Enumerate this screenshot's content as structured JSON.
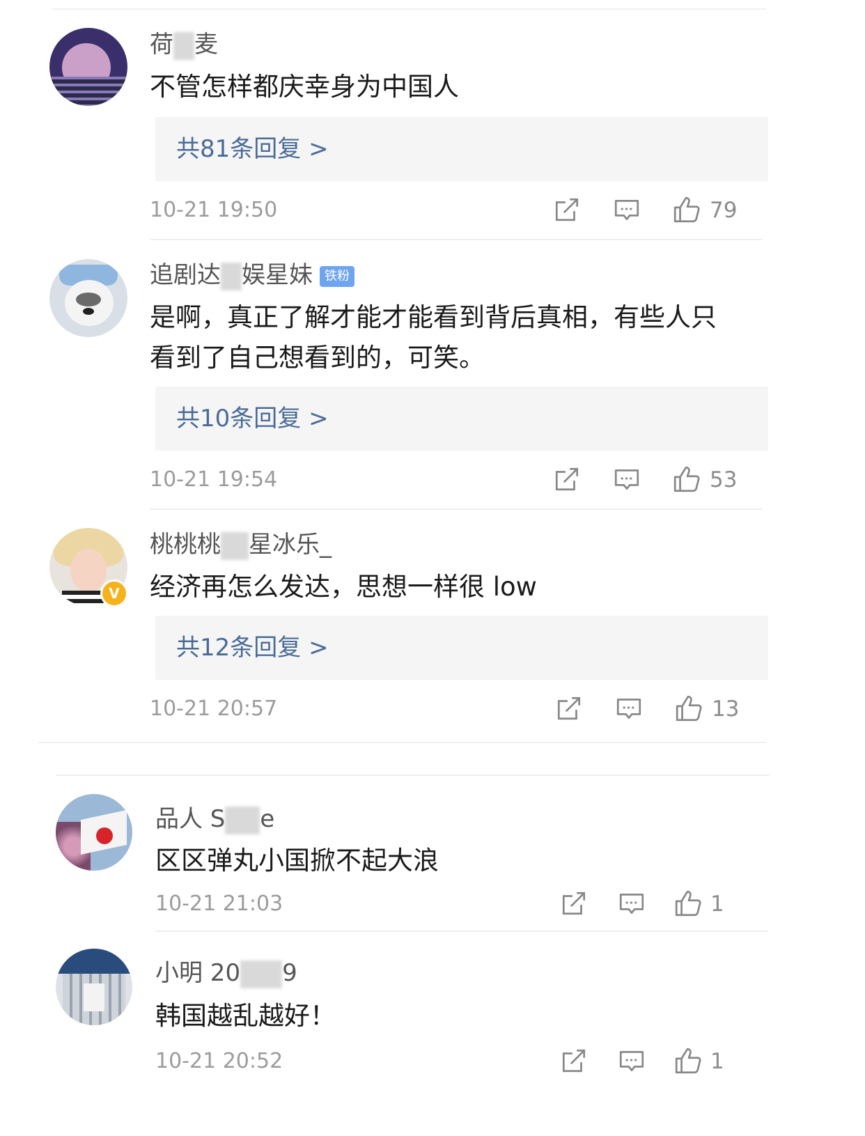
{
  "comments": [
    {
      "username_pre": "荷",
      "username_post": "麦",
      "text": "不管怎样都庆幸身为中国人",
      "replies": "共81条回复 >",
      "time": "10-21 19:50",
      "likes": "79"
    },
    {
      "username_pre": "追剧达",
      "username_post": "娱星妹",
      "badge": "铁粉",
      "text": "是啊，真正了解才能才能看到背后真相，有些人只看到了自己想看到的，可笑。",
      "replies": "共10条回复 >",
      "time": "10-21 19:54",
      "likes": "53"
    },
    {
      "username_pre": "桃桃桃",
      "username_post": "星冰乐_",
      "verified": "V",
      "text": "经济再怎么发达，思想一样很 low",
      "replies": "共12条回复 >",
      "time": "10-21 20:57",
      "likes": "13"
    },
    {
      "username_pre": "品人 S",
      "username_post": "e",
      "text": "区区弹丸小国掀不起大浪",
      "time": "10-21 21:03",
      "likes": "1"
    },
    {
      "username_pre": "小明 20",
      "username_post": "9",
      "text": "韩国越乱越好！",
      "time": "10-21 20:52",
      "likes": "1"
    }
  ],
  "icons": {
    "share": "share-icon",
    "comment": "comment-icon",
    "like": "thumbs-up-icon"
  },
  "colors": {
    "reply_link": "#4a6b96",
    "badge": "#6fa4ee",
    "verified": "#f6b21b"
  }
}
